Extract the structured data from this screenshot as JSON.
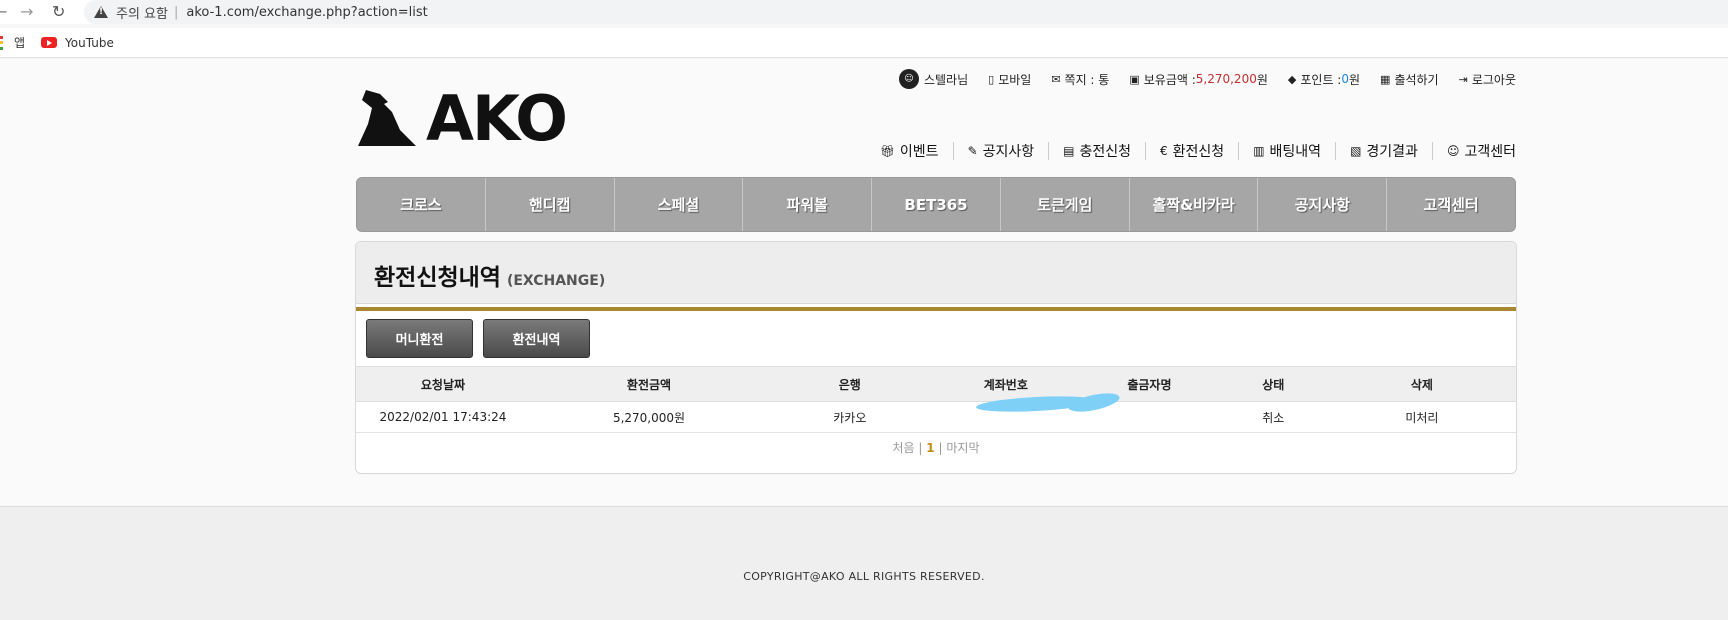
{
  "browser": {
    "warning_label": "주의 요함",
    "separator": "|",
    "url": "ako-1.com/exchange.php?action=list",
    "bookmarks": {
      "apps": "앱",
      "youtube": "YouTube"
    }
  },
  "logo": {
    "text": "AKO"
  },
  "topbar": {
    "user": "스텔라님",
    "mobile": "모바일",
    "message": "쪽지 : 통",
    "balance_label": "보유금액 : ",
    "balance_value": "5,270,200",
    "balance_unit": "원",
    "points_label": "포인트 : ",
    "points_value": "0",
    "points_unit": "원",
    "attendance": "출석하기",
    "logout": "로그아웃"
  },
  "subnav": [
    "이벤트",
    "공지사항",
    "충전신청",
    "환전신청",
    "배팅내역",
    "경기결과",
    "고객센터"
  ],
  "mainmenu": [
    "크로스",
    "핸디캡",
    "스페셜",
    "파워볼",
    "BET365",
    "토큰게임",
    "홀짝&바카라",
    "공지사항",
    "고객센터"
  ],
  "panel": {
    "title": "환전신청내역",
    "subtitle": "(EXCHANGE)",
    "buttons": [
      "머니환전",
      "환전내역"
    ],
    "columns": [
      "요청날짜",
      "환전금액",
      "은행",
      "계좌번호",
      "출금자명",
      "상태",
      "삭제"
    ],
    "rows": [
      {
        "date": "2022/02/01 17:43:24",
        "amount": "5,270,000원",
        "bank": "카카오",
        "account": "",
        "name": "",
        "status": "취소",
        "delete": "미처리"
      }
    ],
    "pager": {
      "first": "처음",
      "sep1": "|",
      "current": "1",
      "sep2": "|",
      "last": "마지막"
    }
  },
  "footer": {
    "copyright": "COPYRIGHT@AKO ALL RIGHTS RESERVED."
  }
}
